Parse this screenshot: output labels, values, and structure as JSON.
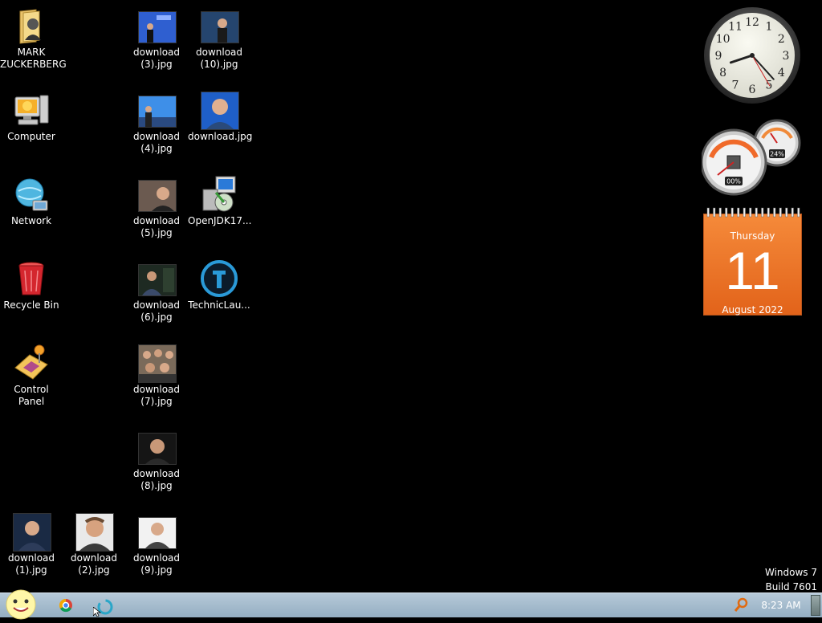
{
  "desktop": {
    "icons": [
      {
        "label": "MARK\nZUCKERBERG",
        "icon": "folder-icon"
      },
      {
        "label": "Computer",
        "icon": "computer-icon"
      },
      {
        "label": "Network",
        "icon": "network-icon"
      },
      {
        "label": "Recycle Bin",
        "icon": "recycle-bin-icon"
      },
      {
        "label": "Control Panel",
        "icon": "control-panel-icon"
      },
      {
        "label": "download\n(1).jpg",
        "icon": "image-thumbnail"
      },
      {
        "label": "download\n(2).jpg",
        "icon": "image-thumbnail"
      },
      {
        "label": "download\n(3).jpg",
        "icon": "image-thumbnail"
      },
      {
        "label": "download\n(4).jpg",
        "icon": "image-thumbnail"
      },
      {
        "label": "download\n(5).jpg",
        "icon": "image-thumbnail"
      },
      {
        "label": "download\n(6).jpg",
        "icon": "image-thumbnail"
      },
      {
        "label": "download\n(7).jpg",
        "icon": "image-thumbnail"
      },
      {
        "label": "download\n(8).jpg",
        "icon": "image-thumbnail"
      },
      {
        "label": "download\n(9).jpg",
        "icon": "image-thumbnail"
      },
      {
        "label": "download\n(10).jpg",
        "icon": "image-thumbnail"
      },
      {
        "label": "download.jpg",
        "icon": "image-thumbnail"
      },
      {
        "label": "OpenJDK17...",
        "icon": "installer-icon"
      },
      {
        "label": "TechnicLau...",
        "icon": "technic-launcher-icon"
      }
    ]
  },
  "gadgets": {
    "clock": {
      "hour": 8,
      "minute": 23,
      "numbers": [
        "12",
        "1",
        "2",
        "3",
        "4",
        "5",
        "6",
        "7",
        "8",
        "9",
        "10",
        "11"
      ]
    },
    "cpu_meter": {
      "cpu_percent_label": "00%",
      "memory_percent_label": "24%",
      "cpu": 0,
      "memory": 24
    },
    "calendar": {
      "weekday": "Thursday",
      "day": "11",
      "month_year": "August 2022"
    }
  },
  "watermark": {
    "line1": "Windows 7",
    "line2": "Build 7601"
  },
  "taskbar": {
    "time": "8:23 AM",
    "colors": {
      "bar": "#a8bfd1",
      "calendar": "#ef7a2c"
    }
  }
}
